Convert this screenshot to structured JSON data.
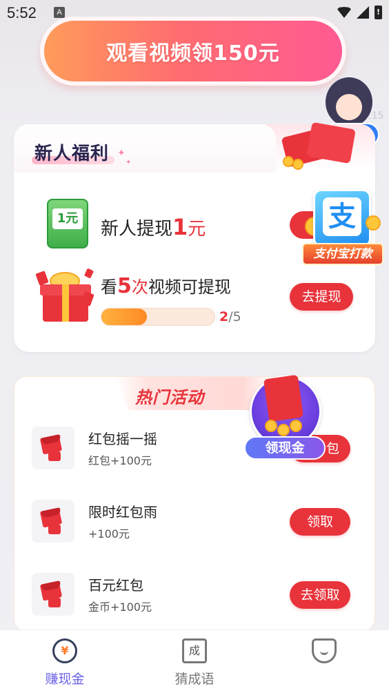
{
  "status_bar": {
    "time": "5:52",
    "notification_glyph": "A",
    "battery_glyph": "!"
  },
  "top_banner": {
    "label": "观看视频领150元"
  },
  "support": {
    "icon": "customer-service-avatar",
    "badge_text": ":15"
  },
  "welfare": {
    "title": "新人福利",
    "withdraw": {
      "icon_text": "1元",
      "prefix": "新人提现",
      "amount": "1",
      "unit": "元"
    },
    "alipay": {
      "glyph": "支",
      "label": "支付宝打款"
    },
    "video": {
      "prefix": "看",
      "count": "5",
      "unit": "次",
      "suffix": "视频可提现",
      "progress_current": "2",
      "progress_total": "/5",
      "progress_fraction": 0.4,
      "button": "去提现"
    }
  },
  "hot": {
    "title": "热门活动",
    "deco_label": "领现金",
    "activities": [
      {
        "title": "红包摇一摇",
        "subtitle": "红包+100元",
        "button": "包"
      },
      {
        "title": "限时红包雨",
        "subtitle": "+100元",
        "button": "领取"
      },
      {
        "title": "百元红包",
        "subtitle": "金币+100元",
        "button": "去领取"
      }
    ]
  },
  "nav": {
    "items": [
      {
        "label": "赚现金",
        "icon_text": "¥",
        "active": true
      },
      {
        "label": "猜成语",
        "icon_text": "成",
        "active": false
      },
      {
        "label": "",
        "icon_text": "",
        "active": false
      }
    ]
  },
  "colors": {
    "accent_red": "#e8333b",
    "nav_active": "#6c63e6",
    "banner_gradient_start": "#ff9b5a",
    "banner_gradient_end": "#ff5a92"
  }
}
